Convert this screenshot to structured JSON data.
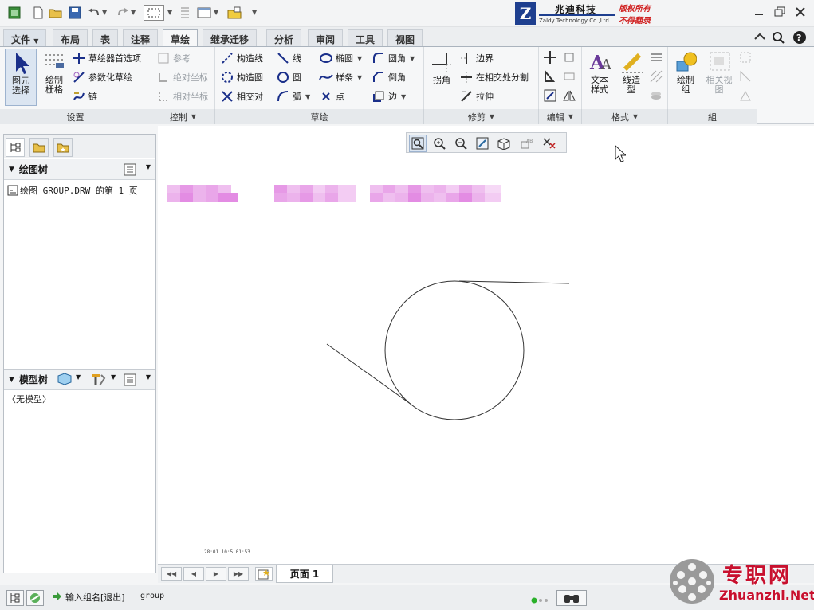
{
  "quick_access": {
    "icons": [
      "app-icon",
      "new-icon",
      "open-icon",
      "save-icon",
      "undo-icon",
      "redo-icon",
      "select-box-icon",
      "regenerate-icon",
      "windows-icon",
      "close-window-icon",
      "customize-icon"
    ]
  },
  "logo": {
    "letter": "Z",
    "company_cn": "兆迪科技",
    "company_en": "Zaldy Technology Co.,Ltd.",
    "copyright1": "版权所有",
    "copyright2": "不得翻录"
  },
  "menu_tabs": [
    "文件",
    "布局",
    "表",
    "注释",
    "草绘",
    "继承迁移",
    "分析",
    "审阅",
    "工具",
    "视图"
  ],
  "active_tab": "草绘",
  "ribbon": {
    "setup": {
      "select_label": "图元\n选择",
      "grid_label": "绘制\n栅格",
      "sketch_prefs": "草绘器首选项",
      "param_sketch": "参数化草绘",
      "chain": "链",
      "group_label": "设置"
    },
    "control": {
      "reference": "参考",
      "absolute_coord": "绝对坐标",
      "relative_coord": "相对坐标",
      "group_label": "控制"
    },
    "sketch": {
      "construction_line": "构造线",
      "construction_circle": "构造圆",
      "intersection": "相交对",
      "line": "线",
      "circle": "圆",
      "arc": "弧",
      "ellipse": "椭圆",
      "spline": "样条",
      "point": "点",
      "fillet": "圆角",
      "chamfer": "倒角",
      "edge": "边",
      "group_label": "草绘"
    },
    "trim": {
      "corner": "拐角",
      "boundary": "边界",
      "split_at_intersect": "在相交处分割",
      "stretch": "拉伸",
      "group_label": "修剪"
    },
    "edit": {
      "group_label": "编辑"
    },
    "format": {
      "text_style": "文本\n样式",
      "line_style": "线造\n型",
      "group_label": "格式"
    },
    "group": {
      "draw_group": "绘制\n组",
      "related_view": "相关视\n图",
      "group_label": "組"
    }
  },
  "left_panel": {
    "drawing_tree_title": "绘图树",
    "drawing_tree_item": "绘图 GROUP.DRW 的第 1 页",
    "model_tree_title": "模型树",
    "model_tree_item": "〈无模型〉"
  },
  "canvas": {
    "coords_text": "28:01  10:5  01:53"
  },
  "page_bar": {
    "page_label": "页面 1"
  },
  "status_bar": {
    "message": "输入组名[退出]",
    "input_value": "group"
  },
  "watermark": {
    "cn": "专职网",
    "en": "Zhuanzhi.Net"
  },
  "colors": {
    "accent_blue": "#1e3f8f",
    "ribbon_bg": "#f6f7f8",
    "watermark_red": "#c8102e"
  }
}
